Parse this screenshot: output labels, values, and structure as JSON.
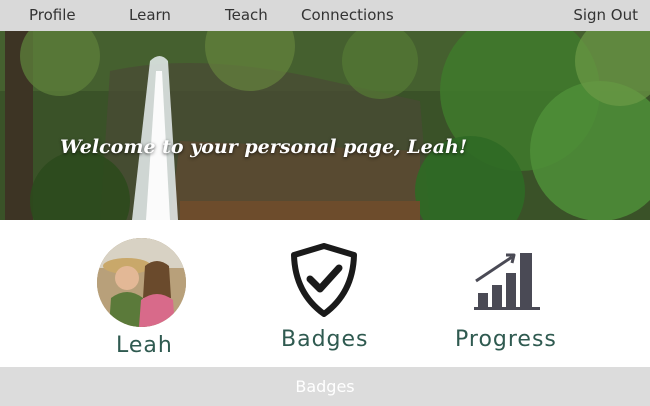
{
  "nav": {
    "profile": "Profile",
    "learn": "Learn",
    "teach": "Teach",
    "connections": "Connections",
    "sign_out": "Sign Out"
  },
  "hero": {
    "welcome": "Welcome to your personal page, Leah!"
  },
  "tiles": {
    "profile_label": "Leah",
    "badges_label": "Badges",
    "progress_label": "Progress"
  },
  "icons": {
    "badges": "shield-check-icon",
    "progress": "bar-chart-growth-icon"
  },
  "bottom": {
    "label": "Badges"
  },
  "colors": {
    "nav_bg": "#d9d9d9",
    "label_color": "#2f5a50",
    "icon_color": "#1a1a1a",
    "chart_color": "#4a4a55"
  }
}
